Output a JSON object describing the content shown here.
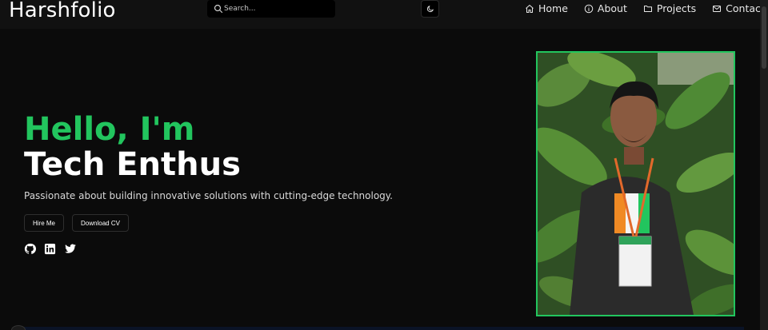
{
  "header": {
    "logo": "Harshfolio",
    "search_placeholder": "Search...",
    "theme_toggle_icon": "moon-icon",
    "nav": [
      {
        "label": "Home",
        "icon": "home-icon"
      },
      {
        "label": "About",
        "icon": "info-icon"
      },
      {
        "label": "Projects",
        "icon": "folder-icon"
      },
      {
        "label": "Contact",
        "icon": "mail-icon"
      }
    ]
  },
  "hero": {
    "greeting": "Hello, I'm",
    "role": "Tech Enthus",
    "tagline": "Passionate about building innovative solutions with cutting-edge technology.",
    "buttons": {
      "hire": "Hire Me",
      "cv": "Download CV"
    },
    "socials": [
      "github-icon",
      "linkedin-icon",
      "twitter-icon"
    ]
  },
  "colors": {
    "accent": "#22c55e",
    "background": "#0b0b0b",
    "navbar": "#111111"
  }
}
